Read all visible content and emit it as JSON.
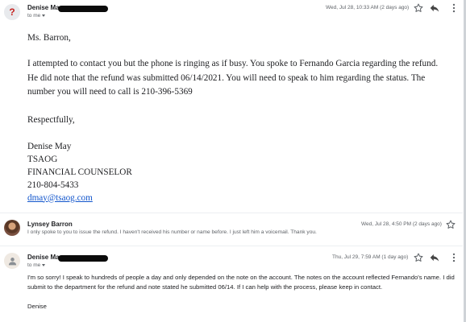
{
  "message1": {
    "avatar": "?",
    "sender": "Denise May",
    "to": "to me",
    "date": "Wed, Jul 28, 10:33 AM (2 days ago)",
    "body": {
      "greeting": "Ms. Barron,",
      "paragraph": "I attempted to contact you but the phone is ringing as if busy. You spoke to Fernando Garcia regarding the refund. He did note that the refund was submitted 06/14/2021. You will need to speak to him regarding the status. The number you will need to call is 210-396-5369",
      "closing": "Respectfully,",
      "sig_name": "Denise May",
      "sig_org": "TSAOG",
      "sig_title": "FINANCIAL COUNSELOR",
      "sig_phone": "210-804-5433",
      "sig_email": "dmay@tsaog.com"
    }
  },
  "message2": {
    "sender": "Lynsey Barron",
    "date": "Wed, Jul 28, 4:50 PM (2 days ago)",
    "snippet": "I only spoke to you to issue the refund. I haven't received his number or name before. I just left him a voicemail. Thank you."
  },
  "message3": {
    "sender": "Denise May",
    "to": "to me",
    "date": "Thu, Jul 29, 7:59 AM (1 day ago)",
    "body": {
      "paragraph": "I'm so sorry! I speak to hundreds of people a day and only depended on the note on the account.  The notes on the account reflected Fernando's name. I did submit to the department for the refund and note stated he submitted 06/14. If I can help with the process, please keep in contact.",
      "sign": "Denise"
    }
  },
  "icons": [
    "star-icon",
    "reply-icon",
    "more-vert-icon",
    "person-icon",
    "caret-down-icon"
  ]
}
